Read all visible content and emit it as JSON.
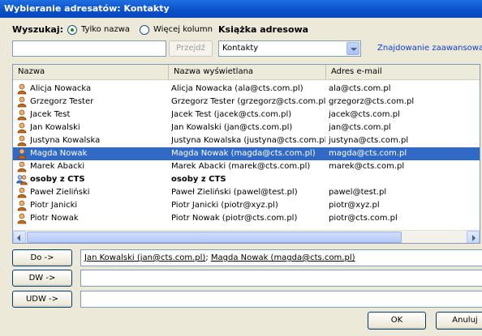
{
  "window": {
    "title": "Wybieranie adresatów: Kontakty"
  },
  "search": {
    "label": "Wyszukaj:",
    "option_name": "Tylko nazwa",
    "option_more": "Więcej kolumn",
    "selected_option": "Tylko nazwa",
    "value": "",
    "go_label": "Przejdź"
  },
  "addressbook": {
    "label": "Książka adresowa",
    "selected": "Kontakty",
    "advanced_link": "Znajdowanie zaawansowane"
  },
  "columns": [
    "Nazwa",
    "Nazwa wyświetlana",
    "Adres e-mail"
  ],
  "contacts": [
    {
      "name": "Alicja Nowacka",
      "display": "Alicja Nowacka (ala@cts.com.pl)",
      "email": "ala@cts.com.pl",
      "type": "contact",
      "selected": false
    },
    {
      "name": "Grzegorz Tester",
      "display": "Grzegorz Tester (grzegorz@cts.com.pl)",
      "email": "grzegorz@cts.com.pl",
      "type": "contact",
      "selected": false
    },
    {
      "name": "Jacek Test",
      "display": "Jacek Test (jacek@cts.com.pl)",
      "email": "jacek@cts.com.pl",
      "type": "contact",
      "selected": false
    },
    {
      "name": "Jan Kowalski",
      "display": "Jan Kowalski (jan@cts.com.pl)",
      "email": "jan@cts.com.pl",
      "type": "contact",
      "selected": false
    },
    {
      "name": "Justyna Kowalska",
      "display": "Justyna Kowalska (justyna@cts.com.pl)",
      "email": "justyna@cts.com.pl",
      "type": "contact",
      "selected": false
    },
    {
      "name": "Magda Nowak",
      "display": "Magda Nowak (magda@cts.com.pl)",
      "email": "magda@cts.com.pl",
      "type": "contact",
      "selected": true
    },
    {
      "name": "Marek Abacki",
      "display": "Marek Abacki (marek@cts.com.pl)",
      "email": "marek@cts.com.pl",
      "type": "contact",
      "selected": false
    },
    {
      "name": "osoby z CTS",
      "display": "osoby z CTS",
      "email": "",
      "type": "group",
      "selected": false
    },
    {
      "name": "Paweł Zieliński",
      "display": "Paweł Zieliński (pawel@test.pl)",
      "email": "pawel@test.pl",
      "type": "contact",
      "selected": false
    },
    {
      "name": "Piotr Janicki",
      "display": "Piotr Janicki (piotr@xyz.pl)",
      "email": "piotr@xyz.pl",
      "type": "contact",
      "selected": false
    },
    {
      "name": "Piotr Nowak",
      "display": "Piotr Nowak (piotr@cts.com.pl)",
      "email": "piotr@cts.com.pl",
      "type": "contact",
      "selected": false
    }
  ],
  "recipients": {
    "to_label": "Do ->",
    "cc_label": "DW ->",
    "bcc_label": "UDW ->",
    "to": [
      "Jan Kowalski (jan@cts.com.pl)",
      "Magda Nowak (magda@cts.com.pl)"
    ],
    "separator": "; ",
    "cc": "",
    "bcc": ""
  },
  "buttons": {
    "ok": "OK",
    "cancel": "Anuluj"
  },
  "colors": {
    "titlebar": "#0b4fc9",
    "selection": "#316ac5",
    "link": "#0c3ed6",
    "dialog": "#ece9d8"
  }
}
